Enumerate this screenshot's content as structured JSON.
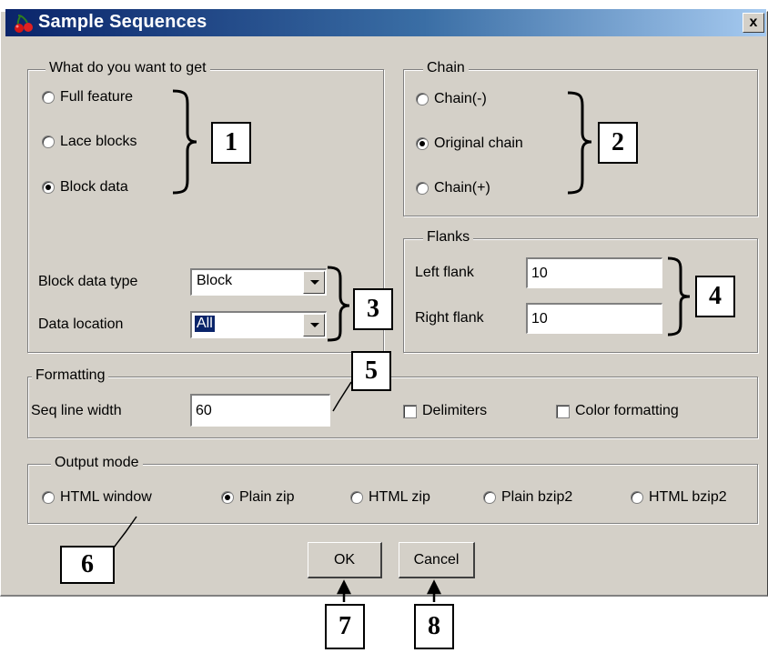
{
  "window": {
    "title": "Sample Sequences",
    "close_glyph": "x"
  },
  "get_group": {
    "legend": "What do you want to get",
    "options": [
      {
        "label": "Full feature",
        "selected": false
      },
      {
        "label": "Lace blocks",
        "selected": false
      },
      {
        "label": "Block data",
        "selected": true
      }
    ],
    "block_data_type": {
      "label": "Block data type",
      "value": "Block"
    },
    "data_location": {
      "label": "Data location",
      "value": "All"
    }
  },
  "chain_group": {
    "legend": "Chain",
    "options": [
      {
        "label": "Chain(-)",
        "selected": false
      },
      {
        "label": "Original chain",
        "selected": true
      },
      {
        "label": "Chain(+)",
        "selected": false
      }
    ]
  },
  "flanks_group": {
    "legend": "Flanks",
    "left": {
      "label": "Left flank",
      "value": "10"
    },
    "right": {
      "label": "Right flank",
      "value": "10"
    }
  },
  "formatting_group": {
    "legend": "Formatting",
    "seq_line_width": {
      "label": "Seq line width",
      "value": "60"
    },
    "delimiters": {
      "label": "Delimiters",
      "checked": false
    },
    "color_formatting": {
      "label": "Color formatting",
      "checked": false
    }
  },
  "output_group": {
    "legend": "Output mode",
    "options": [
      {
        "label": "HTML window",
        "selected": false
      },
      {
        "label": "Plain zip",
        "selected": true
      },
      {
        "label": "HTML zip",
        "selected": false
      },
      {
        "label": "Plain bzip2",
        "selected": false
      },
      {
        "label": "HTML bzip2",
        "selected": false
      }
    ]
  },
  "buttons": {
    "ok": "OK",
    "cancel": "Cancel"
  },
  "callouts": [
    "1",
    "2",
    "3",
    "4",
    "5",
    "6",
    "7",
    "8"
  ]
}
